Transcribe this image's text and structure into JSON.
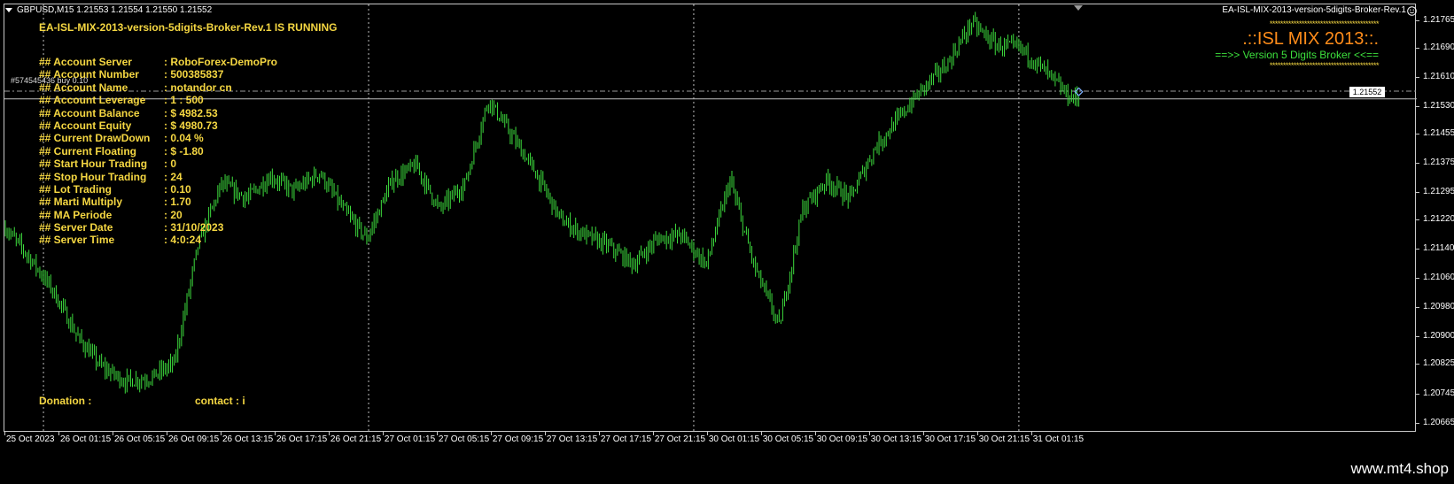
{
  "window": {
    "symbol_line": "GBPUSD,M15  1.21553 1.21554 1.21550 1.21552",
    "ea_name": "EA-ISL-MIX-2013-version-5digits-Broker-Rev.1"
  },
  "status": {
    "title": "EA-ISL-MIX-2013-version-5digits-Broker-Rev.1 IS RUNNING"
  },
  "account_info": [
    {
      "label": "## Account Server",
      "value": ": RoboForex-DemoPro"
    },
    {
      "label": "## Account Number",
      "value": ": 500385837"
    },
    {
      "label": "## Account Name",
      "value": ": notandor cn"
    },
    {
      "label": "## Account Leverage",
      "value": ": 1 : 500"
    },
    {
      "label": "## Account Balance",
      "value": ": $ 4982.53"
    },
    {
      "label": "## Account Equity",
      "value": ": $ 4980.73"
    },
    {
      "label": "## Current DrawDown",
      "value": ": 0.04 %"
    },
    {
      "label": "## Current Floating",
      "value": ": $ -1.80"
    },
    {
      "label": "## Start Hour Trading",
      "value": ": 0"
    },
    {
      "label": "## Stop Hour Trading",
      "value": ": 24"
    },
    {
      "label": "## Lot Trading",
      "value": ": 0.10"
    },
    {
      "label": "## Marti Multiply",
      "value": ": 1.70"
    },
    {
      "label": "## MA Periode",
      "value": ": 20"
    },
    {
      "label": "## Server Date",
      "value": ": 31/10/2023"
    },
    {
      "label": "## Server Time",
      "value": ": 4:0:24"
    }
  ],
  "trade_label": "#574545436 buy 0.10",
  "donation_label": "Donation :",
  "contact_label": "contact : i",
  "brand": {
    "stars": "*****************************************",
    "title": ".::ISL MIX 2013::.",
    "subtitle": "==>>  Version 5 Digits Broker  <<=="
  },
  "watermark": "www.mt4.shop",
  "current_price": "1.21552",
  "colors": {
    "background": "#000000",
    "candle": "#3ddc3d",
    "info_text": "#f5d742",
    "brand_orange": "#ff8c1a",
    "brand_green": "#3de03d"
  },
  "chart_data": {
    "type": "candlestick",
    "symbol": "GBPUSD",
    "timeframe": "M15",
    "last_bar": {
      "open": 1.21553,
      "high": 1.21554,
      "low": 1.2155,
      "close": 1.21552
    },
    "ylim": [
      1.2064,
      1.2181
    ],
    "price_ticks": [
      1.21765,
      1.2169,
      1.2161,
      1.2153,
      1.21455,
      1.21375,
      1.21295,
      1.2122,
      1.2114,
      1.2106,
      1.2098,
      1.209,
      1.20825,
      1.20745,
      1.20665
    ],
    "time_ticks": [
      "25 Oct 2023",
      "26 Oct 01:15",
      "26 Oct 05:15",
      "26 Oct 09:15",
      "26 Oct 13:15",
      "26 Oct 17:15",
      "26 Oct 21:15",
      "27 Oct 01:15",
      "27 Oct 05:15",
      "27 Oct 09:15",
      "27 Oct 13:15",
      "27 Oct 17:15",
      "27 Oct 21:15",
      "30 Oct 01:15",
      "30 Oct 05:15",
      "30 Oct 09:15",
      "30 Oct 13:15",
      "30 Oct 17:15",
      "30 Oct 21:15",
      "31 Oct 01:15"
    ],
    "path_keypoints": [
      [
        0,
        1.212
      ],
      [
        13,
        1.2112
      ],
      [
        26,
        1.2103
      ],
      [
        40,
        1.209
      ],
      [
        53,
        1.2082
      ],
      [
        66,
        1.2078
      ],
      [
        80,
        1.2079
      ],
      [
        93,
        1.2083
      ],
      [
        106,
        1.2115
      ],
      [
        119,
        1.2132
      ],
      [
        133,
        1.2128
      ],
      [
        146,
        1.2134
      ],
      [
        159,
        1.213
      ],
      [
        173,
        1.2135
      ],
      [
        186,
        1.2125
      ],
      [
        199,
        1.2117
      ],
      [
        213,
        1.2133
      ],
      [
        226,
        1.2137
      ],
      [
        239,
        1.2125
      ],
      [
        253,
        1.2132
      ],
      [
        266,
        1.2155
      ],
      [
        279,
        1.2145
      ],
      [
        292,
        1.2135
      ],
      [
        306,
        1.2122
      ],
      [
        319,
        1.2118
      ],
      [
        332,
        1.2115
      ],
      [
        346,
        1.211
      ],
      [
        359,
        1.2117
      ],
      [
        372,
        1.2118
      ],
      [
        386,
        1.211
      ],
      [
        399,
        1.2133
      ],
      [
        412,
        1.211
      ],
      [
        426,
        1.2093
      ],
      [
        439,
        1.2125
      ],
      [
        452,
        1.2133
      ],
      [
        465,
        1.2128
      ],
      [
        479,
        1.2142
      ],
      [
        492,
        1.215
      ],
      [
        505,
        1.2158
      ],
      [
        519,
        1.2165
      ],
      [
        532,
        1.2176
      ],
      [
        545,
        1.217
      ],
      [
        559,
        1.2169
      ],
      [
        572,
        1.2163
      ],
      [
        585,
        1.2156
      ],
      [
        592,
        1.2155
      ]
    ],
    "position_line": 1.21573,
    "bid_line": 1.21552,
    "vertical_separators": [
      "26 Oct 2023",
      "27 Oct 2023",
      "30 Oct 2023",
      "31 Oct 2023"
    ]
  }
}
